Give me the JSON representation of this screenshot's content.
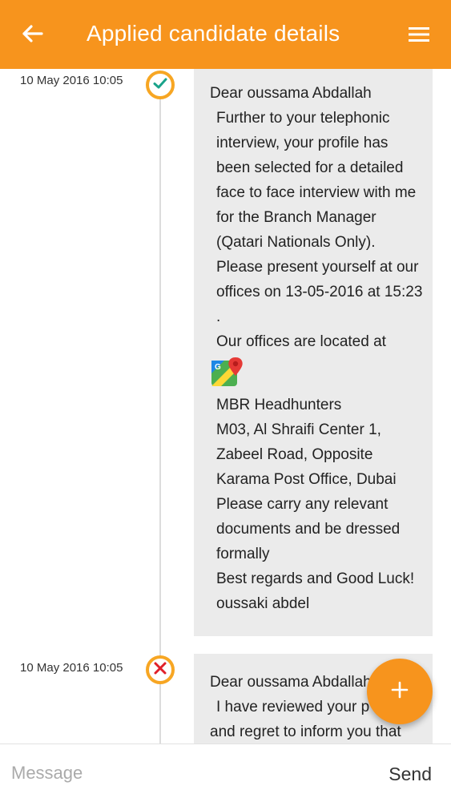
{
  "header": {
    "back_icon": "arrow-left-icon",
    "title": "Applied candidate details",
    "menu_icon": "hamburger-menu-icon",
    "background": "#f7941d"
  },
  "timeline": [
    {
      "timestamp": "10 May 2016 10:05",
      "status_icon": "check-icon",
      "status_color": "#1aa38a",
      "message": {
        "lines": [
          "Dear oussama Abdallah",
          "Further to your telephonic interview, your profile has been selected for a detailed face to face interview with me for the Branch Manager (Qatari Nationals Only).",
          "Please present yourself at our offices on 13-05-2016 at 15:23 .",
          "Our offices are located at",
          "MBR Headhunters",
          "M03, Al Shraifi Center 1, Zabeel Road, Opposite Karama Post Office, Dubai",
          "Please carry any relevant documents and be dressed formally",
          "Best regards and Good Luck!",
          "oussaki abdel"
        ],
        "map_icon": "google-maps-icon"
      }
    },
    {
      "timestamp": "10 May 2016 10:05",
      "status_icon": "cross-icon",
      "status_color": "#e0202a",
      "message": {
        "lines": [
          "Dear oussama Abdallah",
          "I have reviewed your p",
          "and regret to inform you that"
        ]
      }
    }
  ],
  "fab": {
    "icon": "plus-icon",
    "color": "#f7941d"
  },
  "composer": {
    "placeholder": "Message",
    "value": "",
    "send_label": "Send"
  }
}
